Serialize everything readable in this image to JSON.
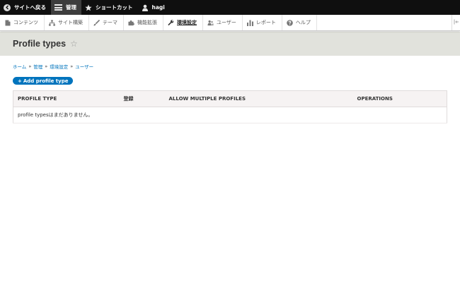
{
  "topbar": {
    "back_label": "サイトへ戻る",
    "manage_label": "管理",
    "shortcuts_label": "ショートカット",
    "user_label": "hagi"
  },
  "tray": {
    "items": [
      {
        "label": "コンテンツ",
        "icon": "file-icon"
      },
      {
        "label": "サイト構築",
        "icon": "sitemap-icon"
      },
      {
        "label": "テーマ",
        "icon": "brush-icon"
      },
      {
        "label": "機能拡張",
        "icon": "puzzle-icon"
      },
      {
        "label": "環境設定",
        "icon": "wrench-icon"
      },
      {
        "label": "ユーザー",
        "icon": "people-icon"
      },
      {
        "label": "レポート",
        "icon": "bar-chart-icon"
      },
      {
        "label": "ヘルプ",
        "icon": "help-icon"
      }
    ]
  },
  "header": {
    "title": "Profile types"
  },
  "breadcrumb": {
    "items": [
      "ホーム",
      "管理",
      "環境設定",
      "ユーザー"
    ],
    "separator": "»"
  },
  "actions": {
    "add_label": "Add profile type",
    "add_prefix": "+"
  },
  "table": {
    "headers": [
      "PROFILE TYPE",
      "登録",
      "ALLOW MULTIPLE PROFILES",
      "OPERATIONS"
    ],
    "empty_message": "profile typesはまだありません。"
  },
  "colors": {
    "link": "#0074bd",
    "topbar_bg": "#0f0f0f",
    "header_bg": "#e1e2dc"
  }
}
